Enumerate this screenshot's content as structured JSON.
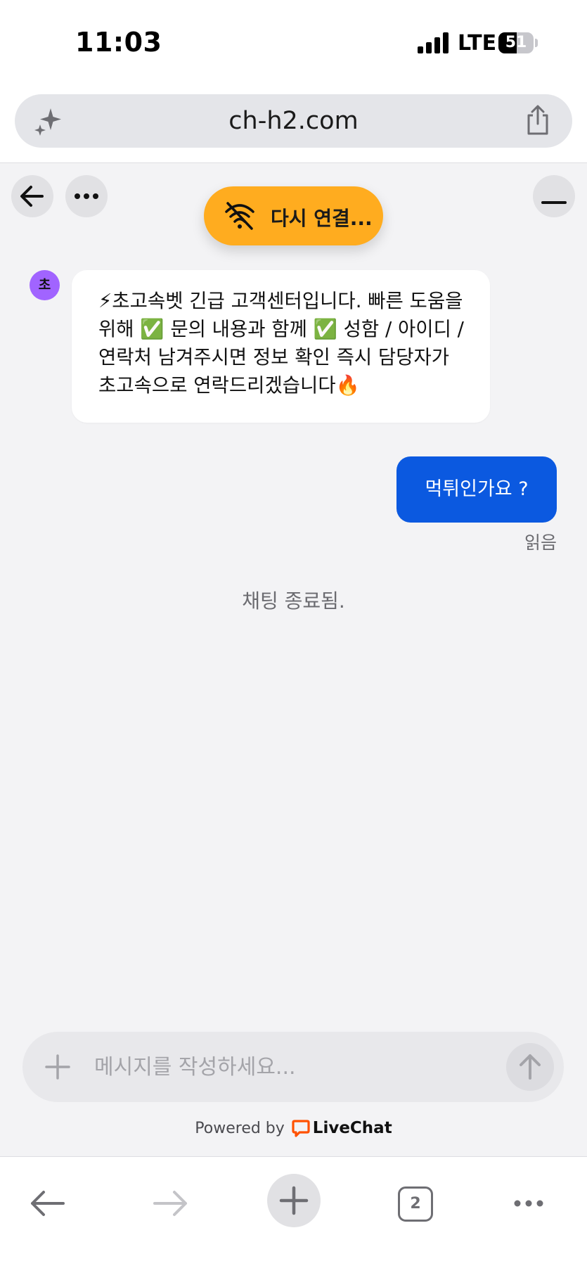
{
  "status_bar": {
    "time": "11:03",
    "network": "LTE",
    "battery_level": "51",
    "battery_fraction": 0.51
  },
  "browser": {
    "url": "ch-h2.com",
    "tabs_count": "2"
  },
  "chat": {
    "reconnect_label": "다시 연결...",
    "agent_avatar_initial": "초",
    "agent_message": "⚡초고속벳 긴급 고객센터입니다. 빠른 도움을 위해 ✅ 문의 내용과 함께 ✅ 성함 / 아이디 / 연락처 남겨주시면 정보 확인 즉시 담당자가 초고속으로 연락드리겠습니다🔥",
    "user_message": "먹튀인가요 ?",
    "read_receipt": "읽음",
    "system_message": "채팅 종료됨."
  },
  "composer": {
    "placeholder": "메시지를 작성하세요...",
    "value": ""
  },
  "footer": {
    "powered_by": "Powered by",
    "brand": "LiveChat"
  },
  "colors": {
    "accent_blue": "#0b59e0",
    "reconnect_orange": "#ffac1f",
    "avatar_purple": "#a164ff",
    "livechat_orange": "#ff5100"
  },
  "icons": {
    "back": "arrow-left-icon",
    "more": "ellipsis-icon",
    "minimize": "minimize-icon",
    "wifi_off": "wifi-off-icon",
    "sparkle": "sparkle-icon",
    "share": "share-icon",
    "attach": "plus-icon",
    "send": "arrow-up-icon"
  }
}
